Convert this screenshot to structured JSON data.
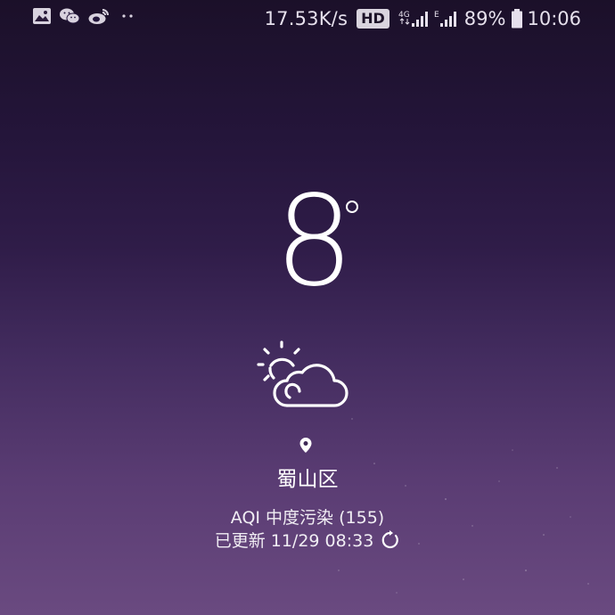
{
  "status_bar": {
    "notification_icons": [
      "gallery-icon",
      "wechat-icon",
      "weibo-icon",
      "more-dots-icon"
    ],
    "net_speed": "17.53K/s",
    "hd_badge": "HD",
    "network_type": "4G",
    "secondary_network": "E",
    "battery_percent": "89%",
    "time": "10:06"
  },
  "weather": {
    "temperature": "8",
    "condition_icon": "partly-cloudy-icon",
    "location": "蜀山区",
    "aqi": "AQI 中度污染 (155)",
    "updated": "已更新 11/29 08:33"
  },
  "colors": {
    "background_top": "#1b1029",
    "background_bottom": "#6a4a80",
    "foreground": "#ffffff"
  }
}
